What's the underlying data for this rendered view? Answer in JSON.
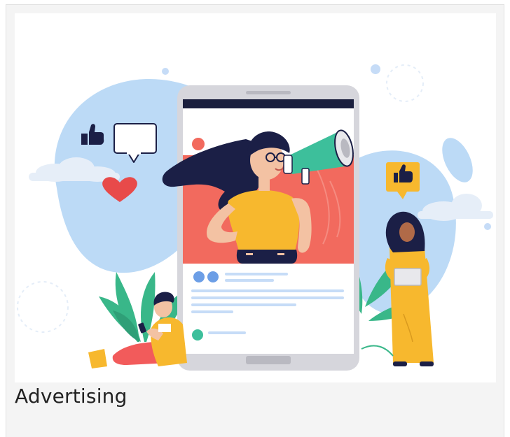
{
  "caption": "Advertising",
  "illustration": {
    "colors": {
      "blob": "#bcdaf6",
      "phone_frame": "#d6d6dc",
      "screen_bar": "#1a1f3e",
      "post_red": "#f26a5e",
      "shirt_yellow": "#f7b82e",
      "hair_dark": "#1b1f46",
      "skin": "#f3c2a3",
      "skin_dark": "#b06a48",
      "megaphone_green": "#3dbf9b",
      "leaf_green": "#39b789",
      "heart_red": "#e84a4a",
      "dot_blue": "#6c9ee6",
      "line_blue": "#c6dcf7",
      "pants_red": "#f25b5b"
    },
    "icons": [
      "thumbs-up-icon",
      "speech-bubble-icon",
      "heart-icon",
      "like-badge-icon",
      "megaphone-icon",
      "laptop-icon",
      "phone-icon"
    ]
  }
}
